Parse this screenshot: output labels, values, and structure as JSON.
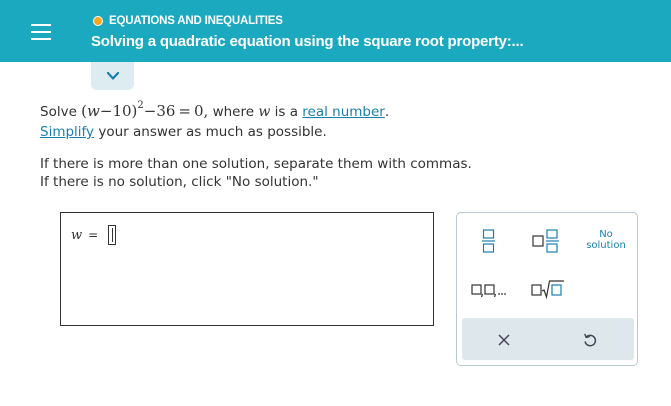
{
  "header": {
    "topic": "EQUATIONS AND INEQUALITIES",
    "title": "Solving a quadratic equation using the square root property:...",
    "menu_icon": "hamburger-menu-icon",
    "topic_dot_color": "#f5a623",
    "bar_color": "#1ba9bf"
  },
  "expand": {
    "icon": "chevron-down-icon"
  },
  "problem": {
    "solve_word": "Solve",
    "eq_open": "(",
    "eq_var": "w",
    "eq_minus_ten": "−10)",
    "eq_exp": "2",
    "eq_rest": "−36 = 0,",
    "where_text": " where ",
    "where_var": "w",
    "is_a": " is a ",
    "real_number_link": "real number",
    "period": ".",
    "simplify_link": "Simplify",
    "simplify_rest": " your answer as much as possible.",
    "instruction_1": "If there is more than one solution, separate them with commas.",
    "instruction_2": "If there is no solution, click \"No solution.\""
  },
  "answer": {
    "var": "w",
    "equals": "=",
    "value": ""
  },
  "keypad": {
    "keys": [
      "fraction-key-icon",
      "mixed-number-key-icon",
      "comma-list-key-icon",
      "radical-key-icon"
    ],
    "no_solution_line1": "No",
    "no_solution_line2": "solution",
    "clear_icon": "clear-x-icon",
    "undo_icon": "undo-icon"
  },
  "colors": {
    "link": "#1a7fb0",
    "keypad_accent": "#1a7fb0"
  }
}
